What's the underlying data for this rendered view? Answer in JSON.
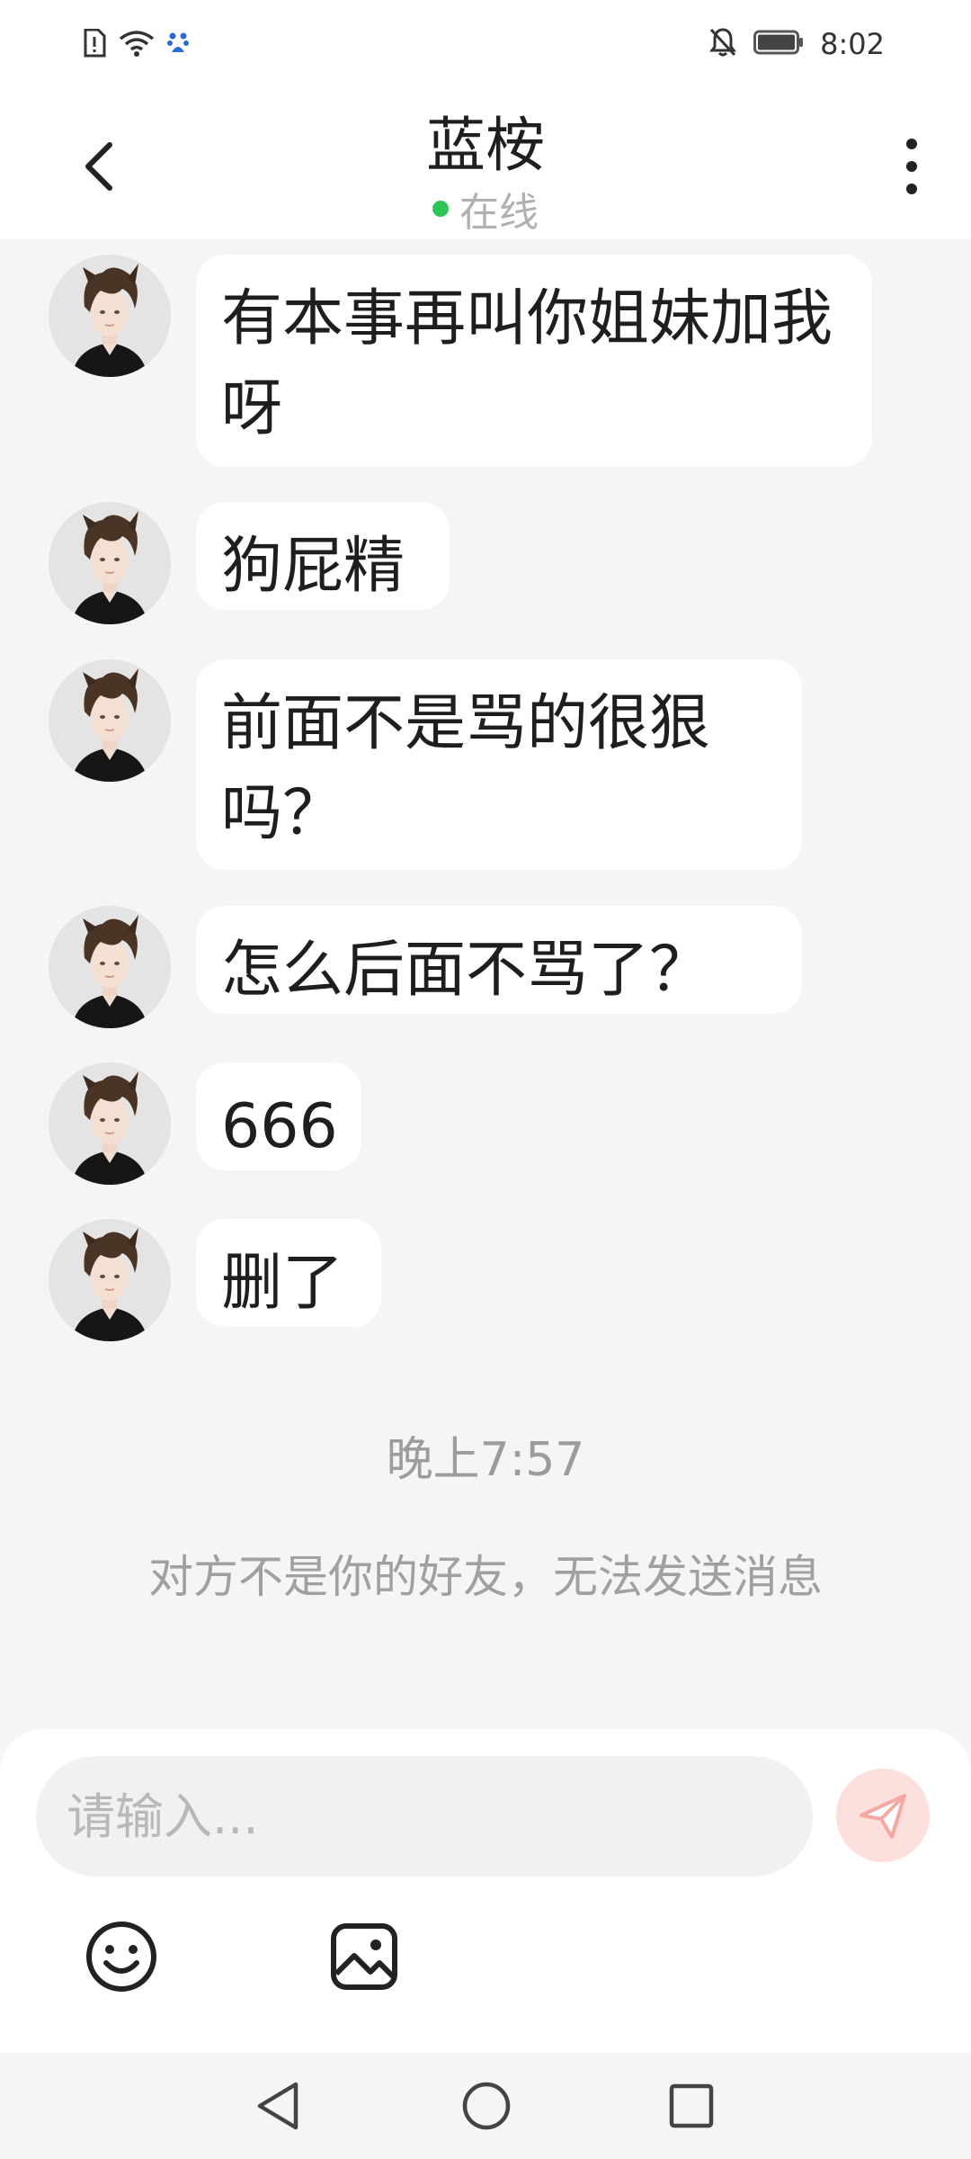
{
  "status_bar": {
    "time": "8:02",
    "left_icons": [
      "sim-alert-icon",
      "wifi-icon",
      "app-notification-icon"
    ],
    "right_icons": [
      "mute-bell-icon",
      "battery-icon"
    ]
  },
  "header": {
    "title": "蓝桉",
    "status_text": "在线",
    "status_color": "#2fc45a"
  },
  "messages": [
    {
      "text": "有本事再叫你姐妹加我呀"
    },
    {
      "text": "狗屁精"
    },
    {
      "text": "前面不是骂的很狠吗？"
    },
    {
      "text": "怎么后面不骂了？"
    },
    {
      "text": "666"
    },
    {
      "text": "删了"
    }
  ],
  "timestamp": "晚上7:57",
  "notice": "对方不是你的好友，无法发送消息",
  "composer": {
    "placeholder": "请输入...",
    "send_icon": "send-paper-plane-icon",
    "accent_color": "#f5a8a0",
    "tools": [
      "emoji-icon",
      "image-icon"
    ]
  },
  "nav_bar": {
    "buttons": [
      "back-triangle-icon",
      "home-circle-icon",
      "recents-square-icon"
    ]
  }
}
